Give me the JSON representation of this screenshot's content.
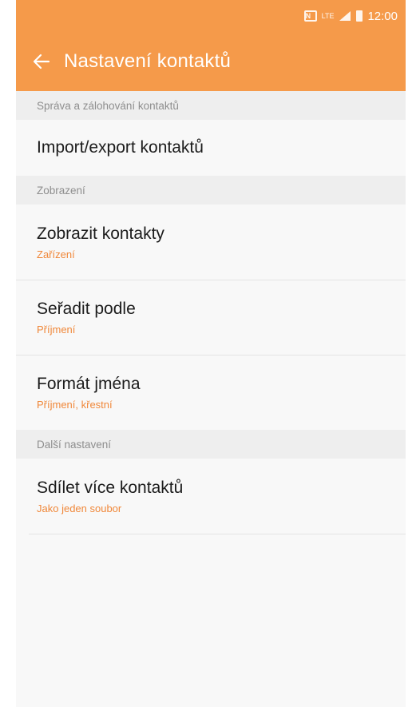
{
  "status_bar": {
    "nfc_icon_text": "N",
    "network_label": "LTE",
    "time": "12:00"
  },
  "app_bar": {
    "title": "Nastavení kontaktů",
    "back_icon": "arrow-left-icon"
  },
  "sections": [
    {
      "header": "Správa a zálohování kontaktů",
      "items": [
        {
          "title": "Import/export kontaktů"
        }
      ]
    },
    {
      "header": "Zobrazení",
      "items": [
        {
          "title": "Zobrazit kontakty",
          "subtitle": "Zařízení"
        },
        {
          "title": "Seřadit podle",
          "subtitle": "Příjmení"
        },
        {
          "title": "Formát jména",
          "subtitle": "Příjmení, křestní"
        }
      ]
    },
    {
      "header": "Další nastavení",
      "items": [
        {
          "title": "Sdílet více kontaktů",
          "subtitle": "Jako jeden soubor"
        }
      ]
    }
  ],
  "colors": {
    "accent": "#f59a4a",
    "subtitle": "#f0883a",
    "section_bg": "#eeeeee"
  }
}
